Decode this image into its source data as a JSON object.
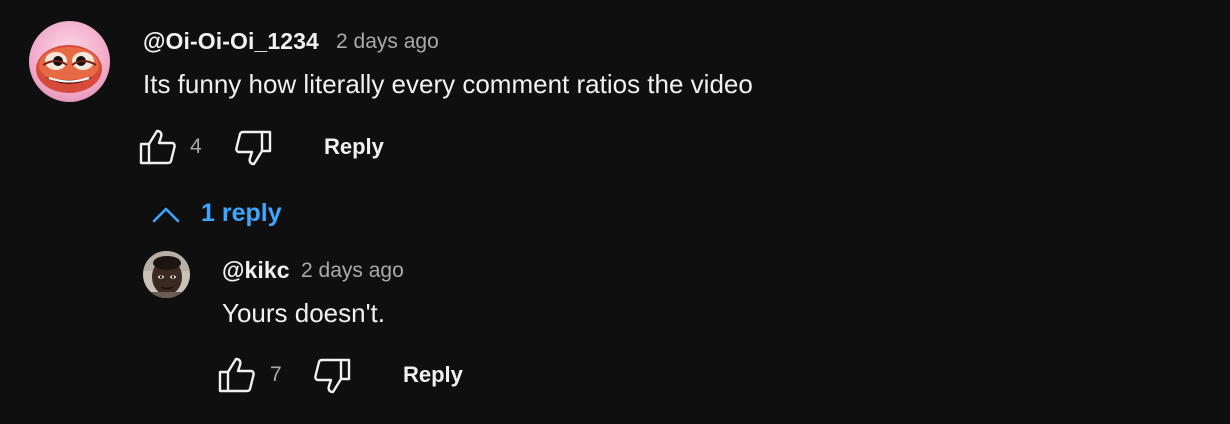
{
  "comments": [
    {
      "author": "@Oi-Oi-Oi_1234",
      "time": "2 days ago",
      "text": "Its funny how literally every comment ratios the video",
      "likes": "4",
      "reply_label": "Reply",
      "avatar_icon": "pepe-frog-avatar"
    }
  ],
  "replies_toggle": {
    "label": "1 reply",
    "icon": "chevron-up-icon",
    "color": "#3ea6ff"
  },
  "replies": [
    {
      "author": "@kikc",
      "time": "2 days ago",
      "text": "Yours doesn't.",
      "likes": "7",
      "reply_label": "Reply",
      "avatar_icon": "user-photo-avatar"
    }
  ],
  "colors": {
    "background": "#0f0f0f",
    "primary_text": "#f1f1f1",
    "secondary_text": "#aaaaaa",
    "link": "#3ea6ff"
  }
}
